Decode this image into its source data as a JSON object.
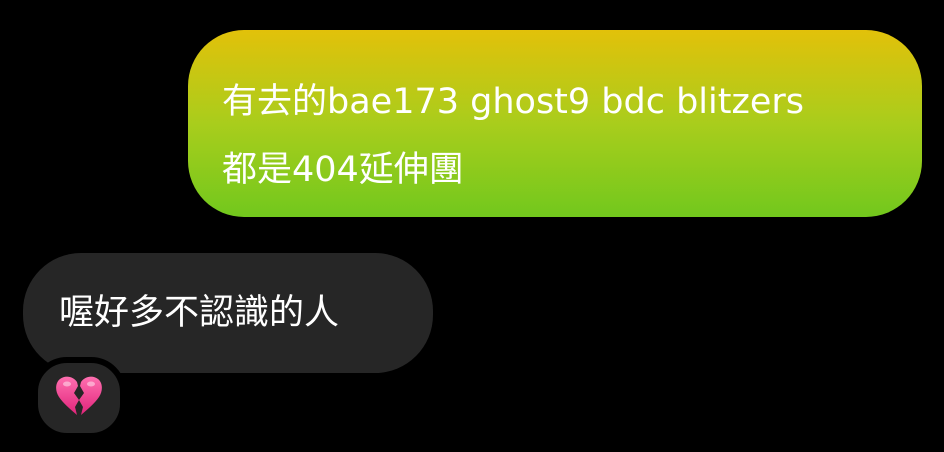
{
  "messages": {
    "outgoing": {
      "line1": "有去的bae173 ghost9 bdc blitzers",
      "line2": "都是404延伸團",
      "gradient_top": "#e2c10a",
      "gradient_bottom": "#72c81d"
    },
    "incoming": {
      "text": "喔好多不認識的人",
      "background": "#262626"
    },
    "reaction": {
      "icon": "broken-heart-icon",
      "color": "#f23e8e"
    }
  }
}
